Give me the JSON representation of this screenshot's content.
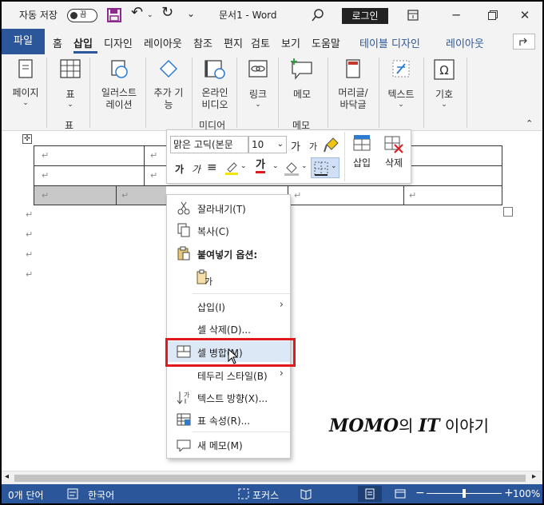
{
  "titlebar": {
    "autosave_label": "자동 저장",
    "autosave_state": "끔",
    "doc_title": "문서1  -  Word",
    "login": "로그인"
  },
  "tabs": {
    "file": "파일",
    "home": "홈",
    "insert": "삽입",
    "design": "디자인",
    "layout": "레이아웃",
    "references": "참조",
    "mailings": "편지",
    "review": "검토",
    "view": "보기",
    "help": "도움말",
    "table_design": "테이블 디자인",
    "table_layout": "레이아웃"
  },
  "ribbon": {
    "pages": "페이지",
    "table": "표",
    "illustrations": "일러스트\n레이션",
    "addins": "추가 기\n능",
    "online_video": "온라인\n비디오",
    "links": "링크",
    "comment": "메모",
    "header_footer": "머리글/\n바닥글",
    "text": "텍스트",
    "symbols": "기호",
    "group_table": "표",
    "group_media": "미디어",
    "group_comment": "메모"
  },
  "minitoolbar": {
    "font": "맑은 고딕(본문",
    "size": "10",
    "grow": "가",
    "shrink": "가",
    "bold": "가",
    "italic": "가",
    "font_color": "가",
    "insert": "삽입",
    "delete": "삭제"
  },
  "context_menu": {
    "cut": "잘라내기(T)",
    "copy": "복사(C)",
    "paste_options": "붙여넣기 옵션:",
    "paste_glyph": "가",
    "insert": "삽입(I)",
    "delete_cells": "셀 삭제(D)...",
    "merge_cells": "셀 병합(M)",
    "border_styles": "테두리 스타일(B)",
    "text_direction": "텍스트 방향(X)...",
    "table_properties": "표 속성(R)...",
    "new_comment": "새 메모(M)"
  },
  "statusbar": {
    "words": "0개 단어",
    "language": "한국어",
    "focus": "포커스",
    "zoom": "100%",
    "zoom_minus": "−",
    "zoom_plus": "+"
  },
  "watermark": {
    "latin1": "MOMO",
    "ko1": "의 ",
    "latin2": "IT",
    "ko2": " 이야기"
  },
  "colors": {
    "accent": "#2b579a",
    "highlight": "#e0191e",
    "selected_cell": "#c8c8c8"
  }
}
